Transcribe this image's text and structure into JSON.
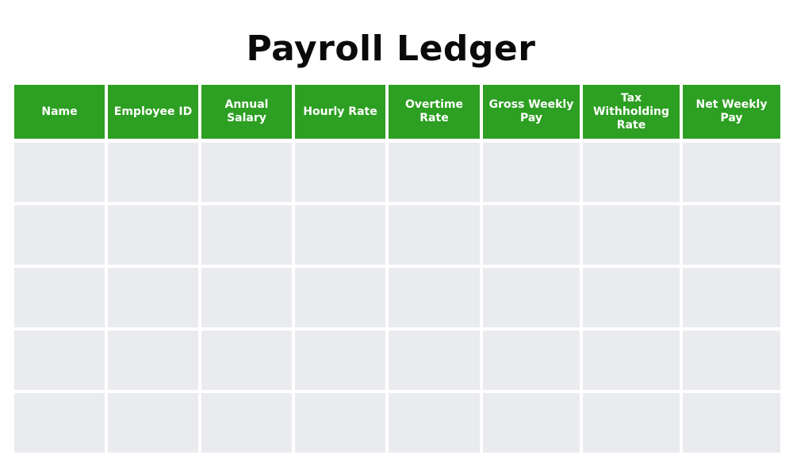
{
  "title": "Payroll Ledger",
  "colors": {
    "header_bg": "#2d9f22",
    "header_text": "#ffffff",
    "cell_bg": "#eaebee"
  },
  "table": {
    "columns": [
      "Name",
      "Employee ID",
      "Annual Salary",
      "Hourly Rate",
      "Overtime Rate",
      "Gross Weekly Pay",
      "Tax Withholding Rate",
      "Net Weekly Pay"
    ],
    "rows": [
      [
        "",
        "",
        "",
        "",
        "",
        "",
        "",
        ""
      ],
      [
        "",
        "",
        "",
        "",
        "",
        "",
        "",
        ""
      ],
      [
        "",
        "",
        "",
        "",
        "",
        "",
        "",
        ""
      ],
      [
        "",
        "",
        "",
        "",
        "",
        "",
        "",
        ""
      ],
      [
        "",
        "",
        "",
        "",
        "",
        "",
        "",
        ""
      ]
    ]
  }
}
